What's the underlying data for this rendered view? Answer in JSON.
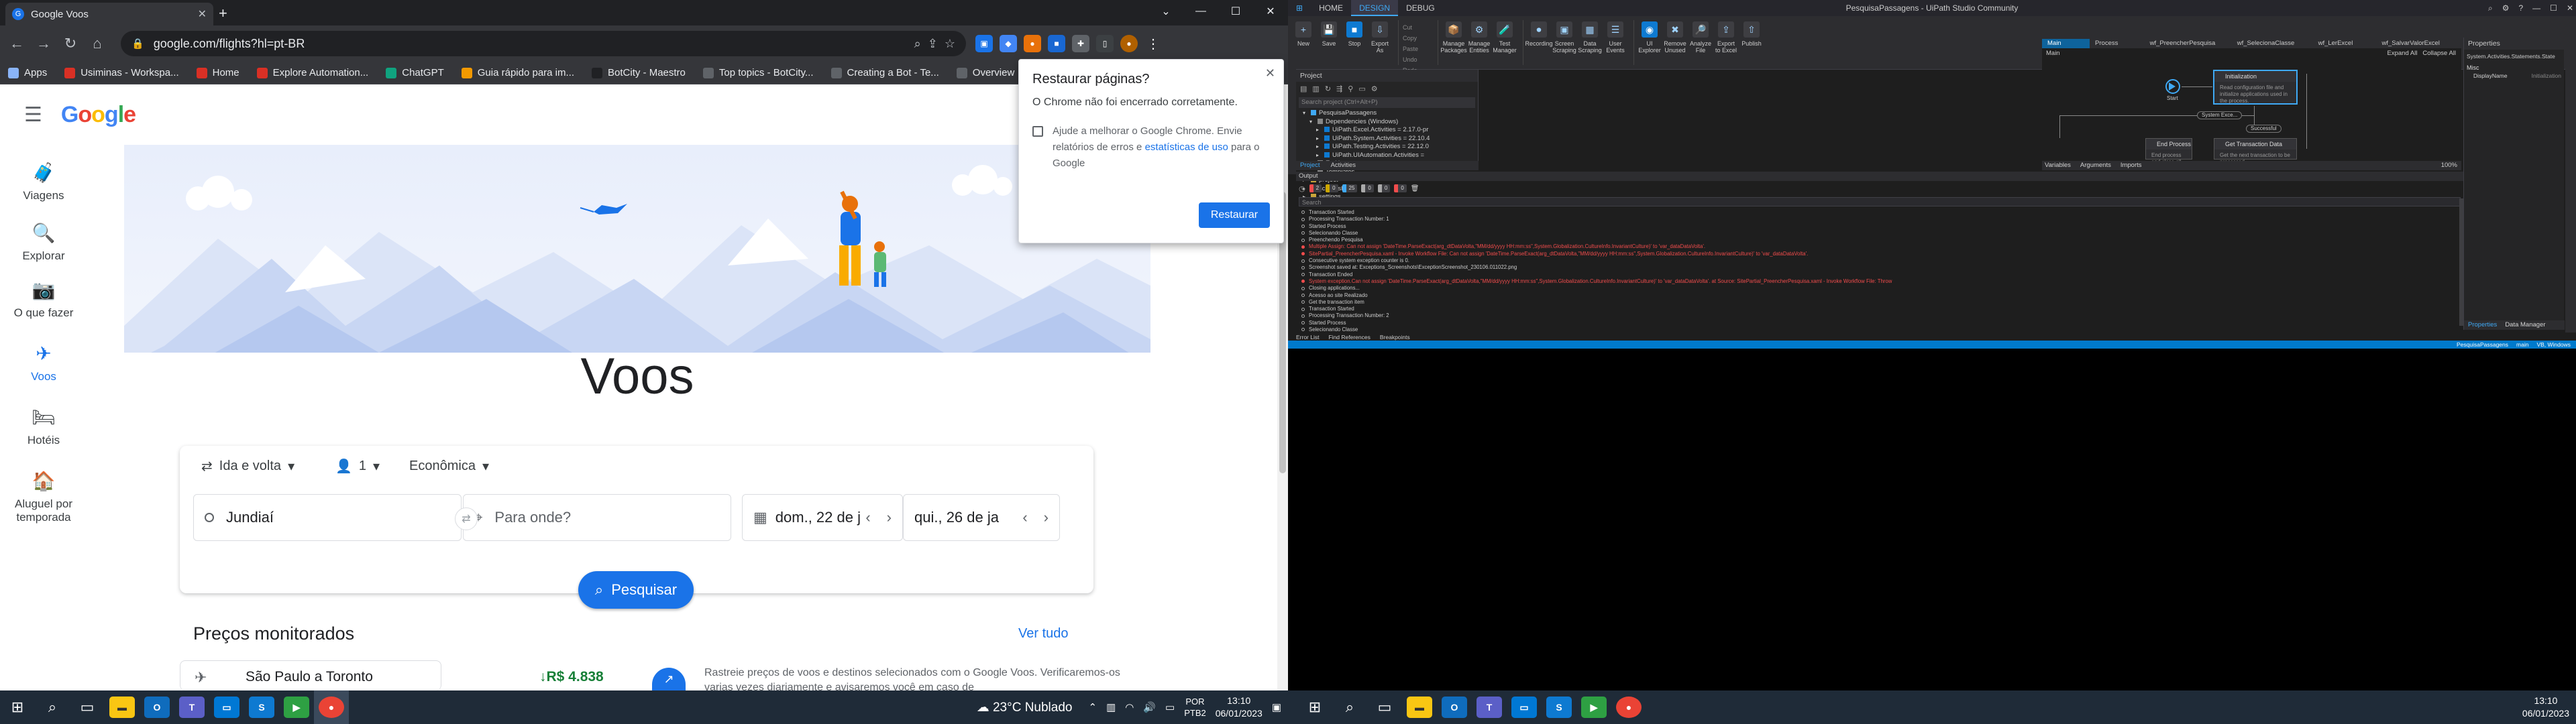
{
  "chrome": {
    "tab_title": "Google Voos",
    "url": "google.com/flights?hl=pt-BR",
    "bookmarks": [
      {
        "label": "Apps",
        "color": "#8ab4f8"
      },
      {
        "label": "Usiminas - Workspa...",
        "color": "#d93025"
      },
      {
        "label": "Home",
        "color": "#d93025"
      },
      {
        "label": "Explore Automation...",
        "color": "#d93025"
      },
      {
        "label": "ChatGPT",
        "color": "#10a37f"
      },
      {
        "label": "Guia rápido para im...",
        "color": "#f29900"
      },
      {
        "label": "BotCity - Maestro",
        "color": "#202124"
      },
      {
        "label": "Top topics - BotCity...",
        "color": "#5f6368"
      },
      {
        "label": "Creating a Bot - Te...",
        "color": "#5f6368"
      },
      {
        "label": "Overview",
        "color": "#5f6368"
      }
    ]
  },
  "flights": {
    "sidebar": [
      {
        "label": "Viagens",
        "icon": "suitcase-icon",
        "glyph": "🧳"
      },
      {
        "label": "Explorar",
        "icon": "explore-icon",
        "glyph": "🔍"
      },
      {
        "label": "O que fazer",
        "icon": "camera-icon",
        "glyph": "📷"
      },
      {
        "label": "Voos",
        "icon": "plane-icon",
        "glyph": "✈"
      },
      {
        "label": "Hotéis",
        "icon": "bed-icon",
        "glyph": "🛏"
      },
      {
        "label": "Aluguel por temporada",
        "icon": "house-icon",
        "glyph": "🏠"
      }
    ],
    "title": "Voos",
    "trip_type": "Ida e volta",
    "passengers": "1",
    "cabin": "Econômica",
    "origin": "Jundiaí",
    "destination_placeholder": "Para onde?",
    "depart_date": "dom., 22 de j",
    "return_date": "qui., 26 de ja",
    "search_label": "Pesquisar",
    "tracked_title": "Preços monitorados",
    "see_all": "Ver tudo",
    "tracked_route": "São Paulo a Toronto",
    "tracked_price": "↓R$ 4.838",
    "tracked_info": "Rastreie preços de voos e destinos selecionados com o Google Voos. Verificaremos-os varias vezes diariamente e avisaremos você em caso de"
  },
  "restore_popup": {
    "title": "Restaurar páginas?",
    "message": "O Chrome não foi encerrado corretamente.",
    "checkbox_text": "Ajude a melhorar o Google Chrome. Envie relatórios de erros e",
    "link_text": "estatísticas de uso",
    "checkbox_tail": "para o Google",
    "button": "Restaurar"
  },
  "taskbar_left": {
    "weather": "23°C  Nublado",
    "lang1": "POR",
    "lang2": "PTB2",
    "time": "13:10",
    "date": "06/01/2023"
  },
  "uipath": {
    "window_title": "PesquisaPassagens - UiPath Studio Community",
    "ribbon_tabs": [
      "HOME",
      "DESIGN",
      "DEBUG"
    ],
    "ribbon_buttons": [
      {
        "label": "New",
        "glyph": "+"
      },
      {
        "label": "Save",
        "glyph": "💾"
      },
      {
        "label": "Stop",
        "glyph": "■"
      },
      {
        "label": "Export As",
        "glyph": "⇩"
      },
      {
        "label": "Manage Packages",
        "glyph": "📦"
      },
      {
        "label": "Manage Entities",
        "glyph": "⚙"
      },
      {
        "label": "Test Manager",
        "glyph": "🧪"
      },
      {
        "label": "Recording",
        "glyph": "⏺"
      },
      {
        "label": "Screen Scraping",
        "glyph": "▣"
      },
      {
        "label": "Data Scraping",
        "glyph": "▦"
      },
      {
        "label": "User Events",
        "glyph": "☰"
      },
      {
        "label": "UI Explorer",
        "glyph": "◉"
      },
      {
        "label": "Remove Unused",
        "glyph": "✖"
      },
      {
        "label": "Analyze File",
        "glyph": "🔎"
      },
      {
        "label": "Export to Excel",
        "glyph": "⇪"
      },
      {
        "label": "Publish",
        "glyph": "⇧"
      }
    ],
    "ribbon_small": [
      "Cut",
      "Copy",
      "Paste",
      "Undo",
      "Redo"
    ],
    "project_header": "Project",
    "project_search": "Search project (Ctrl+Alt+P)",
    "tree": [
      {
        "indent": 1,
        "toggle": "▾",
        "label": "PesquisaPassagens",
        "color": "#3fa9f5"
      },
      {
        "indent": 2,
        "toggle": "▾",
        "label": "Dependencies (Windows)",
        "color": "#888"
      },
      {
        "indent": 3,
        "toggle": "▸",
        "label": "UiPath.Excel.Activities = 2.17.0-pr",
        "color": "#0e7ad1"
      },
      {
        "indent": 3,
        "toggle": "▸",
        "label": "UiPath.System.Activities = 22.10.4",
        "color": "#0e7ad1"
      },
      {
        "indent": 3,
        "toggle": "▸",
        "label": "UiPath.Testing.Activities = 22.12.0",
        "color": "#0e7ad1"
      },
      {
        "indent": 3,
        "toggle": "▸",
        "label": "UiPath.UIAutomation.Activities =",
        "color": "#0e7ad1"
      },
      {
        "indent": 2,
        "toggle": "",
        "label": "Entities",
        "color": "#888"
      },
      {
        "indent": 2,
        "toggle": "",
        "label": "Templates",
        "color": "#888"
      },
      {
        "indent": 1,
        "toggle": "▸",
        "label": "project",
        "color": "#c9a53a"
      },
      {
        "indent": 1,
        "toggle": "▸",
        "label": "screenshots",
        "color": "#c9a53a"
      },
      {
        "indent": 1,
        "toggle": "▸",
        "label": "settings",
        "color": "#c9a53a"
      }
    ],
    "project_tabs": [
      "Project",
      "Activities"
    ],
    "doc_tabs": [
      "Main (ReadOnly)",
      "Process (ReadOnly)",
      "wf_PreencherPesquisa (ReadOnly)",
      "wf_SelecionaClasse (ReadOnly)",
      "wf_LerExcel (ReadOnly)",
      "wf_SalvarValorExcel (ReadOnly)"
    ],
    "designer_crumb": "Main",
    "expand_all": "Expand All",
    "collapse_all": "Collapse All",
    "start_label": "Start",
    "nodes": {
      "init_title": "Initialization",
      "init_body": "Read configuration file and initialize applications used in the process.",
      "end_title": "End Process",
      "end_body": "End process and close all",
      "get_title": "Get Transaction Data",
      "get_body": "Get the next transaction to be processed."
    },
    "pill_system": "System Exce...",
    "pill_success": "Successful",
    "designer_bottom": [
      "Variables",
      "Arguments",
      "Imports"
    ],
    "zoom": "100%",
    "output_header": "Output",
    "output_search": "Search",
    "output_filters": [
      "2",
      "0",
      "25",
      "0",
      "0",
      "0"
    ],
    "log": [
      {
        "t": "Transaction Started",
        "e": false
      },
      {
        "t": "Processing Transaction Number: 1",
        "e": false
      },
      {
        "t": "Started Process",
        "e": false
      },
      {
        "t": "Selecionando Classe",
        "e": false
      },
      {
        "t": "Preenchendo Pesquisa",
        "e": false
      },
      {
        "t": "Multiple Assign: Can not assign 'DateTime.ParseExact(arg_dtDataVolta,\"MM/dd/yyyy HH:mm:ss\",System.Globalization.CultureInfo.InvariantCulture)' to 'var_dataDataVolta'.",
        "e": true
      },
      {
        "t": "SitePartial_PreencherPesquisa.xaml - Invoke Workflow File: Can not assign 'DateTime.ParseExact(arg_dtDataVolta,\"MM/dd/yyyy HH:mm:ss\",System.Globalization.CultureInfo.InvariantCulture)' to 'var_dataDataVolta'.",
        "e": true
      },
      {
        "t": "Consecutive system exception counter is 0.",
        "e": false
      },
      {
        "t": "Screenshot saved at: Exceptions_Screenshots\\ExceptionScreenshot_230106.011022.png",
        "e": false
      },
      {
        "t": "Transaction Ended",
        "e": false
      },
      {
        "t": "System exception.Can not assign 'DateTime.ParseExact(arg_dtDataVolta,\"MM/dd/yyyy HH:mm:ss\",System.Globalization.CultureInfo.InvariantCulture)' to 'var_dataDataVolta'. at Source: SitePartial_PreencherPesquisa.xaml - Invoke Workflow File: Throw",
        "e": true
      },
      {
        "t": "Closing applications...",
        "e": false
      },
      {
        "t": "Acesso ao site Realizado",
        "e": false
      },
      {
        "t": "Get the transaction item",
        "e": false
      },
      {
        "t": "Transaction Started",
        "e": false
      },
      {
        "t": "Processing Transaction Number: 2",
        "e": false
      },
      {
        "t": "Started Process",
        "e": false
      },
      {
        "t": "Selecionando Classe",
        "e": false
      }
    ],
    "output_tabs": [
      "Error List",
      "Find References",
      "Breakpoints"
    ],
    "properties_header": "Properties",
    "properties_type": "System.Activities.Statements.State",
    "properties_category": "Misc",
    "prop_name": "DisplayName",
    "prop_value": "Initialization",
    "props_footer": [
      "Properties",
      "Data Manager"
    ],
    "status_items": [
      "PesquisaPassagens",
      "main",
      "VB, Windows"
    ]
  },
  "taskbar_right": {
    "time": "13:10",
    "date": "06/01/2023"
  }
}
